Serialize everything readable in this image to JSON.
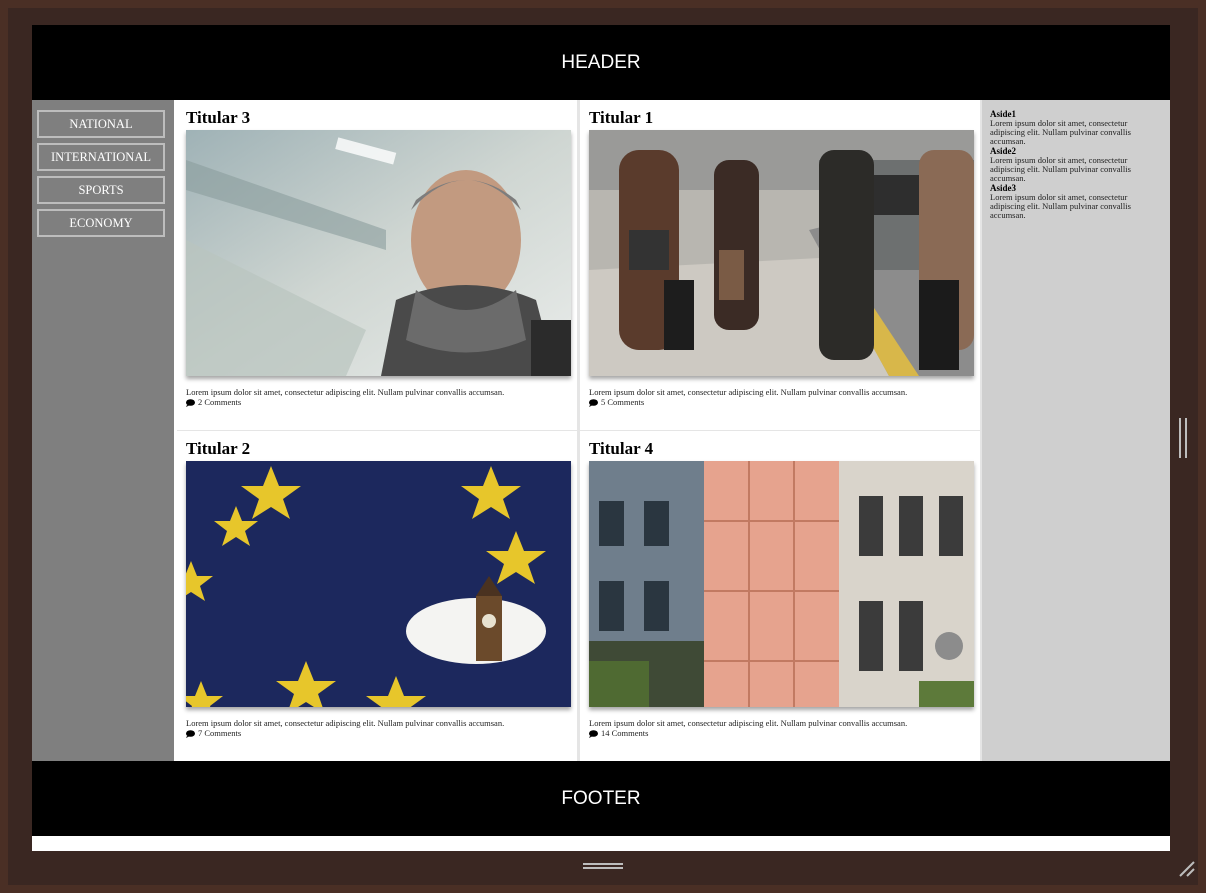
{
  "header": {
    "label": "HEADER"
  },
  "footer": {
    "label": "FOOTER"
  },
  "nav": {
    "items": [
      "NATIONAL",
      "INTERNATIONAL",
      "SPORTS",
      "ECONOMY"
    ]
  },
  "articles": [
    {
      "title": "Titular 3",
      "desc": "Lorem ipsum dolor sit amet, consectetur adipiscing elit. Nullam pulvinar convallis accumsan.",
      "comments": "2 Comments"
    },
    {
      "title": "Titular 1",
      "desc": "Lorem ipsum dolor sit amet, consectetur adipiscing elit. Nullam pulvinar convallis accumsan.",
      "comments": "5 Comments"
    },
    {
      "title": "Titular 2",
      "desc": "Lorem ipsum dolor sit amet, consectetur adipiscing elit. Nullam pulvinar convallis accumsan.",
      "comments": "7 Comments"
    },
    {
      "title": "Titular 4",
      "desc": "Lorem ipsum dolor sit amet, consectetur adipiscing elit. Nullam pulvinar convallis accumsan.",
      "comments": "14 Comments"
    }
  ],
  "aside": {
    "items": [
      {
        "title": "Aside1",
        "text": "Lorem ipsum dolor sit amet, consectetur adipiscing elit. Nullam pulvinar convallis accumsan."
      },
      {
        "title": "Aside2",
        "text": "Lorem ipsum dolor sit amet, consectetur adipiscing elit. Nullam pulvinar convallis accumsan."
      },
      {
        "title": "Aside3",
        "text": "Lorem ipsum dolor sit amet, consectetur adipiscing elit. Nullam pulvinar convallis accumsan."
      }
    ]
  },
  "icons": {
    "comment": "comment-icon"
  },
  "colors": {
    "header_bg": "#000000",
    "nav_bg": "#7f7f7f",
    "aside_bg": "#cfcfcf",
    "frame": "#4a2f25"
  }
}
